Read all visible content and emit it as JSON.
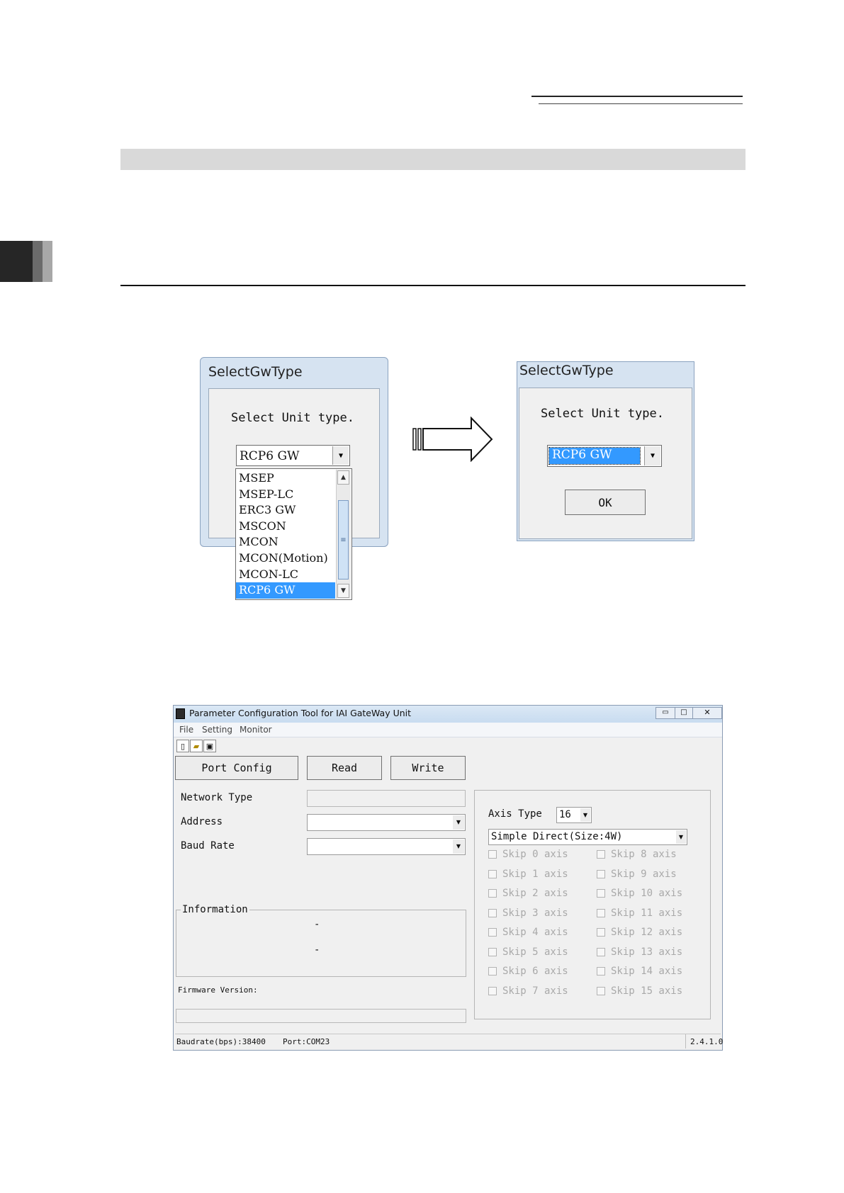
{
  "dialog_left": {
    "title": "SelectGwType",
    "prompt": "Select Unit type.",
    "combo_value": "RCP6 GW",
    "list_items": [
      "MSEP",
      "MSEP-LC",
      "ERC3 GW",
      "MSCON",
      "MCON",
      "MCON(Motion)",
      "MCON-LC",
      "RCP6 GW"
    ],
    "selected_index": 7
  },
  "dialog_right": {
    "title": "SelectGwType",
    "prompt": "Select Unit type.",
    "combo_value": "RCP6 GW",
    "ok_label": "OK"
  },
  "tool_window": {
    "title": "Parameter Configuration Tool for IAI GateWay Unit",
    "menu": [
      "File",
      "Setting",
      "Monitor"
    ],
    "toolbar_icons": [
      "new-file-icon",
      "open-folder-icon",
      "save-disk-icon"
    ],
    "buttons": {
      "port_config": "Port Config",
      "read": "Read",
      "write": "Write"
    },
    "fields": {
      "network_type": "Network Type",
      "address": "Address",
      "baud_rate": "Baud Rate"
    },
    "information": {
      "label": "Information",
      "lines": [
        "-",
        "-"
      ]
    },
    "firmware_label": "Firmware Version:",
    "axis": {
      "label": "Axis Type",
      "axis_count": "16",
      "mode": "Simple Direct(Size:4W)",
      "skip_left": [
        "Skip 0 axis",
        "Skip 1 axis",
        "Skip 2 axis",
        "Skip 3 axis",
        "Skip 4 axis",
        "Skip 5 axis",
        "Skip 6 axis",
        "Skip 7 axis"
      ],
      "skip_right": [
        "Skip 8 axis",
        "Skip 9 axis",
        "Skip 10 axis",
        "Skip 11 axis",
        "Skip 12 axis",
        "Skip 13 axis",
        "Skip 14 axis",
        "Skip 15 axis"
      ]
    },
    "status": {
      "baudrate": "Baudrate(bps):38400",
      "port": "Port:COM23",
      "version": "2.4.1.0"
    }
  }
}
